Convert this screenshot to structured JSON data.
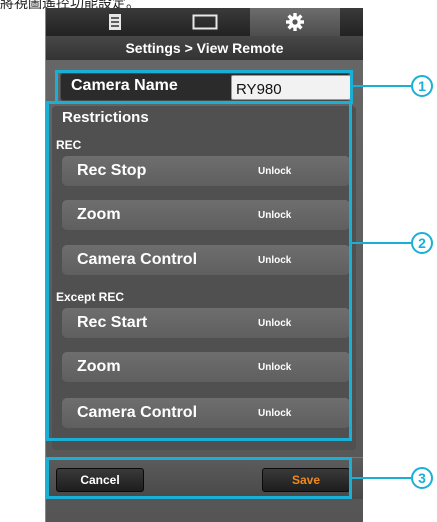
{
  "caption": "將視圖遙控功能設定。",
  "tabs": [
    {
      "icon": "list-icon",
      "active": false
    },
    {
      "icon": "screen-icon",
      "active": false
    },
    {
      "icon": "gear-icon",
      "active": true
    }
  ],
  "header": {
    "title": "Settings > View Remote"
  },
  "camera_name": {
    "label": "Camera Name",
    "value": "RY980"
  },
  "restrictions": {
    "title": "Restrictions",
    "rec": {
      "title": "REC",
      "items": [
        {
          "label": "Rec Stop",
          "state": "Unlock"
        },
        {
          "label": "Zoom",
          "state": "Unlock"
        },
        {
          "label": "Camera Control",
          "state": "Unlock"
        }
      ]
    },
    "except_rec": {
      "title": "Except REC",
      "items": [
        {
          "label": "Rec Start",
          "state": "Unlock"
        },
        {
          "label": "Zoom",
          "state": "Unlock"
        },
        {
          "label": "Camera Control",
          "state": "Unlock"
        }
      ]
    }
  },
  "footer": {
    "cancel_label": "Cancel",
    "save_label": "Save"
  },
  "callouts": [
    "1",
    "2",
    "3"
  ],
  "colors": {
    "callout": "#1ab0d6",
    "save_text": "#f08a1c"
  }
}
